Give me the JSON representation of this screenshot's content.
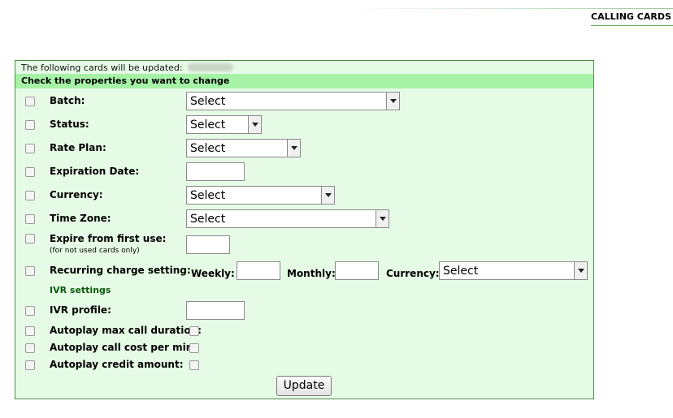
{
  "page": {
    "title": "CALLING CARDS"
  },
  "panel": {
    "info_text": "The following cards will be updated:",
    "header": "Check the properties you want to change",
    "select_placeholder": "Select",
    "fields": {
      "batch": "Batch:",
      "status": "Status:",
      "rate_plan": "Rate Plan:",
      "expiration_date": "Expiration Date:",
      "currency": "Currency:",
      "time_zone": "Time Zone:",
      "expire_first_use": "Expire from first use:",
      "expire_first_use_note": "(for not used cards only)",
      "recurring_charge": "Recurring charge setting:",
      "weekly": "Weekly:",
      "monthly": "Monthly:",
      "recurring_currency": "Currency:"
    },
    "ivr": {
      "section_title": "IVR settings",
      "ivr_profile": "IVR profile:",
      "autoplay_max_call_duration": "Autoplay max call duration:",
      "autoplay_call_cost": "Autoplay call cost per min:",
      "autoplay_credit_amount": "Autoplay credit amount:"
    },
    "update_button": "Update"
  }
}
